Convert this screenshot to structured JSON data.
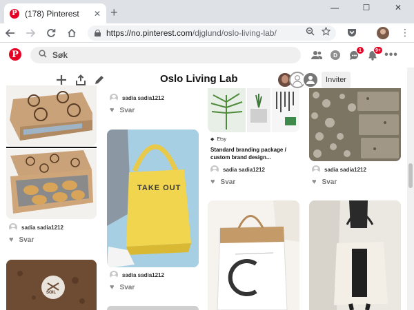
{
  "browser": {
    "tab_title": "(178) Pinterest",
    "favicon_letter": "P",
    "url_prefix": "https://no.pinterest.com",
    "url_path": "/djglund/oslo-living-lab/"
  },
  "header": {
    "logo_letter": "P",
    "search_placeholder": "Søk",
    "profile_initial": "D",
    "messages_badge": "1",
    "notifications_badge": "9+"
  },
  "board": {
    "title": "Oslo Living Lab",
    "invite_label": "Inviter"
  },
  "pins": {
    "col1_top": {
      "user": "sadia sadia1212",
      "reply": "Svar"
    },
    "col2_top": {
      "user": "sadia sadia1212",
      "reply": "Svar"
    },
    "col2_bag": {
      "user": "sadia sadia1212",
      "reply": "Svar",
      "bag_text": "TAKE OUT"
    },
    "col3_top": {
      "source": "Etsy",
      "description": "Standard branding package / custom brand design...",
      "user": "sadia sadia1212",
      "reply": "Svar"
    },
    "col4_top": {
      "user": "sadia sadia1212",
      "reply": "Svar"
    },
    "col1_soil": {
      "soil_text": "SOIL"
    },
    "col2_top_above": {
      "user": "sadia sadia1212",
      "reply": "Svar"
    }
  },
  "colors": {
    "pinterest_red": "#e60023",
    "chrome_tab_bg": "#dee1e6"
  }
}
